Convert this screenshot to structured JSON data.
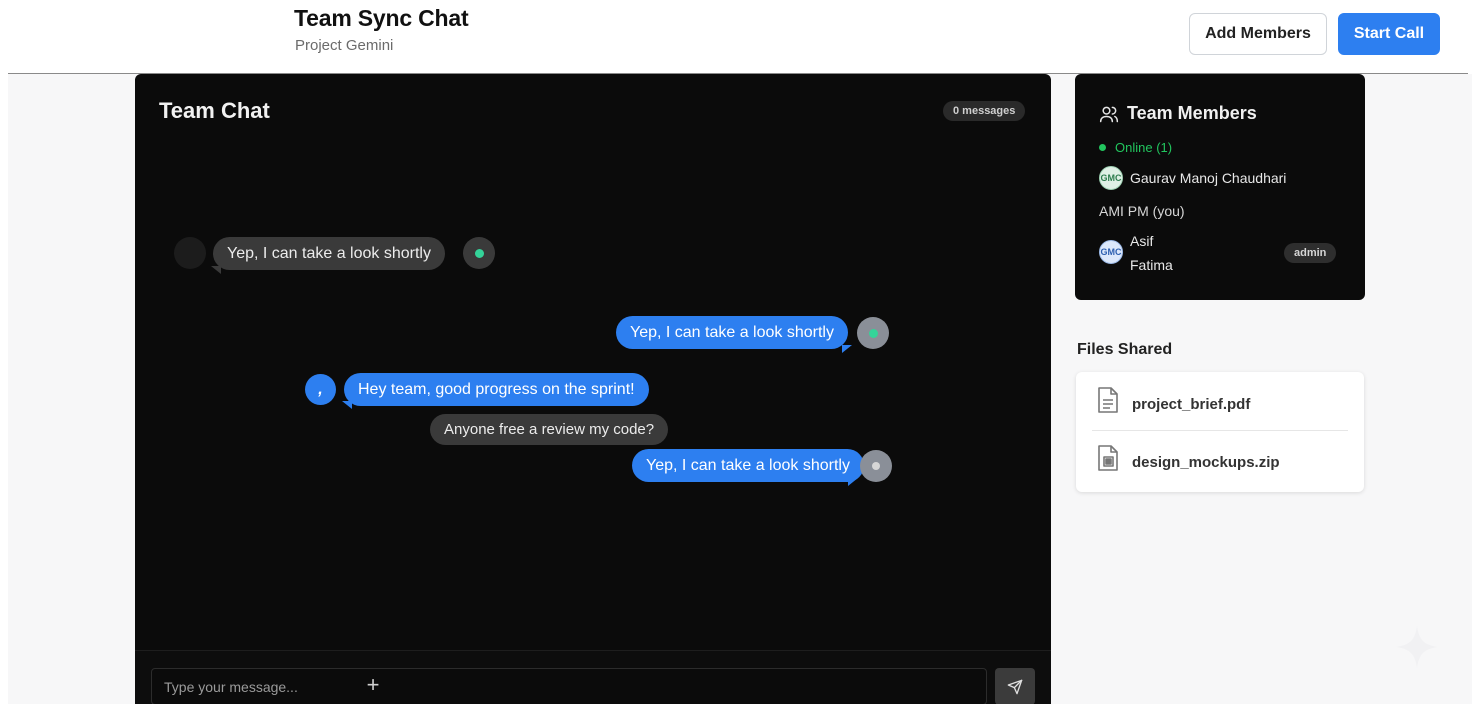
{
  "header": {
    "title": "Team Sync Chat",
    "subtitle": "Project Gemini",
    "add_members_label": "Add Members",
    "start_call_label": "Start Call"
  },
  "chat": {
    "title": "Team Chat",
    "message_count": "0 messages",
    "messages": [
      {
        "text": "Yep, I can take a look shortly",
        "style": "gray"
      },
      {
        "text": "Yep, I can take a look shortly",
        "style": "blue"
      },
      {
        "text": "Hey team, good progress on the sprint!",
        "style": "blue"
      },
      {
        "text": "Anyone free a review my code?",
        "style": "gray"
      },
      {
        "text": "Yep, I can take a look shortly",
        "style": "blue"
      }
    ],
    "input_placeholder": "Type your message..."
  },
  "members": {
    "title": "Team Members",
    "online_label": "Online (1)",
    "list": [
      {
        "name": "Gaurav Manoj Chaudhari",
        "initials": "GMC"
      },
      {
        "name": "AMI PM (you)"
      },
      {
        "name_line1": "Asif",
        "name_line2": "Fatima",
        "initials": "GMC",
        "badge": "admin"
      }
    ]
  },
  "files": {
    "title": "Files Shared",
    "items": [
      {
        "name": "project_brief.pdf",
        "icon": "document-icon"
      },
      {
        "name": "design_mockups.zip",
        "icon": "archive-icon"
      }
    ]
  },
  "colors": {
    "accent": "#2d7ff0",
    "online": "#22c55e",
    "dark_panel": "#0b0b0b",
    "status_teal": "#34d399"
  }
}
